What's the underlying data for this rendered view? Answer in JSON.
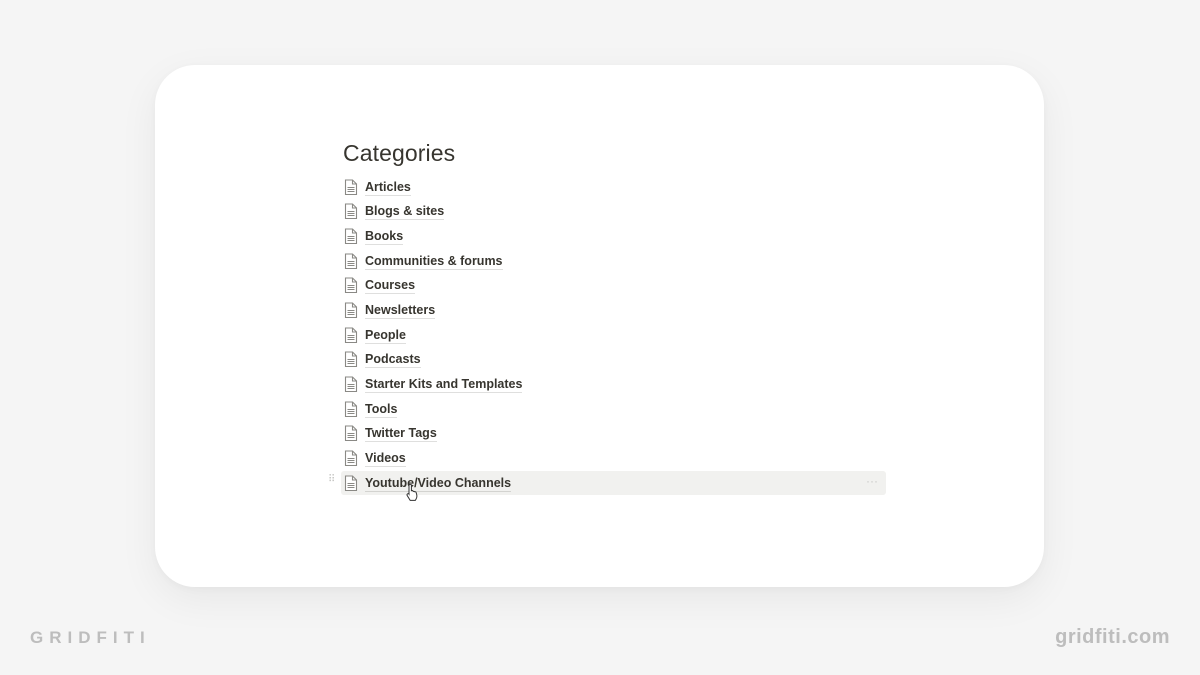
{
  "page": {
    "title": "Categories",
    "items": [
      {
        "label": "Articles",
        "icon": "page-icon"
      },
      {
        "label": "Blogs & sites",
        "icon": "page-icon"
      },
      {
        "label": "Books",
        "icon": "page-icon"
      },
      {
        "label": "Communities & forums",
        "icon": "page-icon"
      },
      {
        "label": "Courses",
        "icon": "page-icon"
      },
      {
        "label": "Newsletters",
        "icon": "page-icon"
      },
      {
        "label": "People",
        "icon": "page-icon"
      },
      {
        "label": "Podcasts",
        "icon": "page-icon"
      },
      {
        "label": "Starter Kits and Templates",
        "icon": "page-icon"
      },
      {
        "label": "Tools",
        "icon": "page-icon"
      },
      {
        "label": "Twitter Tags",
        "icon": "page-icon"
      },
      {
        "label": "Videos",
        "icon": "page-icon"
      },
      {
        "label": "Youtube/Video Channels",
        "icon": "page-icon",
        "hovered": true
      }
    ],
    "drag_handle_glyph": "⠿",
    "more_glyph": "···"
  },
  "branding": {
    "left": "GRIDFITI",
    "right": "gridfiti.com"
  },
  "colors": {
    "background": "#f5f5f5",
    "card": "#ffffff",
    "text": "#37352f",
    "hover_row": "#f1f1ef",
    "brand": "#bdbdbd"
  }
}
